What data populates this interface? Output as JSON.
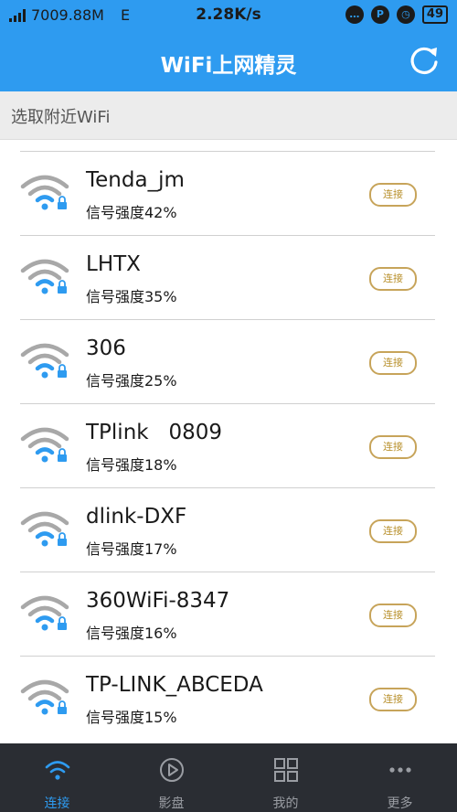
{
  "status_bar": {
    "data_usage": "7009.88M",
    "network_type": "E",
    "speed": "2.28K/s",
    "battery": "49"
  },
  "header": {
    "title": "WiFi上网精灵"
  },
  "section": {
    "label": "选取附近WiFi"
  },
  "networks": [
    {
      "name": "Tenda_jm",
      "signal": "信号强度42%",
      "button": "连接"
    },
    {
      "name": "LHTX",
      "signal": "信号强度35%",
      "button": "连接"
    },
    {
      "name": "306",
      "signal": "信号强度25%",
      "button": "连接"
    },
    {
      "name": "TPlink   0809",
      "signal": "信号强度18%",
      "button": "连接"
    },
    {
      "name": "dlink-DXF",
      "signal": "信号强度17%",
      "button": "连接"
    },
    {
      "name": "360WiFi-8347",
      "signal": "信号强度16%",
      "button": "连接"
    },
    {
      "name": "TP-LINK_ABCEDA",
      "signal": "信号强度15%",
      "button": "连接"
    }
  ],
  "tabs": [
    {
      "label": "连接",
      "icon": "wifi-icon"
    },
    {
      "label": "影盘",
      "icon": "play-icon"
    },
    {
      "label": "我的",
      "icon": "grid-icon"
    },
    {
      "label": "更多",
      "icon": "more-icon"
    }
  ],
  "colors": {
    "accent": "#2e9bf0",
    "button_border": "#c7a45a",
    "tabbar": "#2a2d33"
  }
}
